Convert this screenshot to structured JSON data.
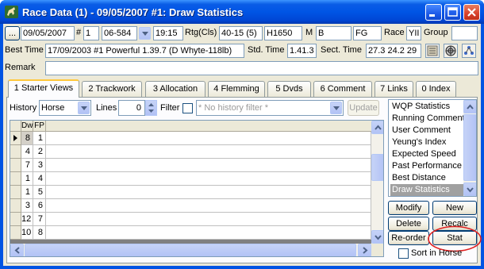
{
  "window": {
    "title": "Race Data (1) - 09/05/2007 #1: Draw Statistics"
  },
  "row1": {
    "ellipsis": "...",
    "date": "09/05/2007",
    "hash_label": "#",
    "race_no": "1",
    "code": "06-584",
    "time": "19:15",
    "rtg_label": "Rtg(Cls)",
    "rating": "40-15 (5)",
    "distance": "H1650",
    "m_label": "M",
    "m_value": "B",
    "going": "FG",
    "race_label": "Race",
    "race_value": "YII",
    "group_label": "Group"
  },
  "row2": {
    "best_time_label": "Best Time",
    "best_time_value": "17/09/2003 #1 Powerful 1.39.7 (D Whyte-118lb)",
    "std_time_label": "Std. Time",
    "std_time_value": "1.41.3",
    "sect_time_label": "Sect. Time",
    "sect_time_value": "27.3  24.2  29"
  },
  "row3": {
    "remark_label": "Remark",
    "remark_value": ""
  },
  "tabs": [
    {
      "label": "1 Starter Views"
    },
    {
      "label": "2 Trackwork"
    },
    {
      "label": "3 Allocation"
    },
    {
      "label": "4 Flemming"
    },
    {
      "label": "5 Dvds"
    },
    {
      "label": "6 Comment"
    },
    {
      "label": "7 Links"
    },
    {
      "label": "0 Index"
    }
  ],
  "filterbar": {
    "history_label": "History",
    "history_value": "Horse",
    "lines_label": "Lines",
    "lines_value": "0",
    "filter_label": "Filter",
    "filter_placeholder": "* No history filter *",
    "update_label": "Update"
  },
  "grid": {
    "columns": [
      "Dw",
      "FP"
    ],
    "rows": [
      {
        "dw": "8",
        "fp": "1"
      },
      {
        "dw": "4",
        "fp": "2"
      },
      {
        "dw": "7",
        "fp": "3"
      },
      {
        "dw": "1",
        "fp": "4"
      },
      {
        "dw": "1",
        "fp": "5"
      },
      {
        "dw": "3",
        "fp": "6"
      },
      {
        "dw": "12",
        "fp": "7"
      },
      {
        "dw": "10",
        "fp": "8"
      }
    ]
  },
  "views": {
    "items": [
      "WQP Statistics",
      "Running Comment",
      "User Comment",
      "Yeung's Index",
      "Expected Speed",
      "Past Performance",
      "Best Distance",
      "Draw Statistics"
    ],
    "selected": "Draw Statistics"
  },
  "actions": {
    "modify": "Modify",
    "new": "New",
    "delete": "Delete",
    "recalc": "Recalc",
    "reorder": "Re-order",
    "stat": "Stat",
    "sort_in_horse": "Sort in Horse"
  },
  "colors": {
    "titlebar": "#0055e5",
    "face": "#ece9d8",
    "highlight_circle": "#e02020",
    "tab_active_accent": "#ffc83c"
  }
}
